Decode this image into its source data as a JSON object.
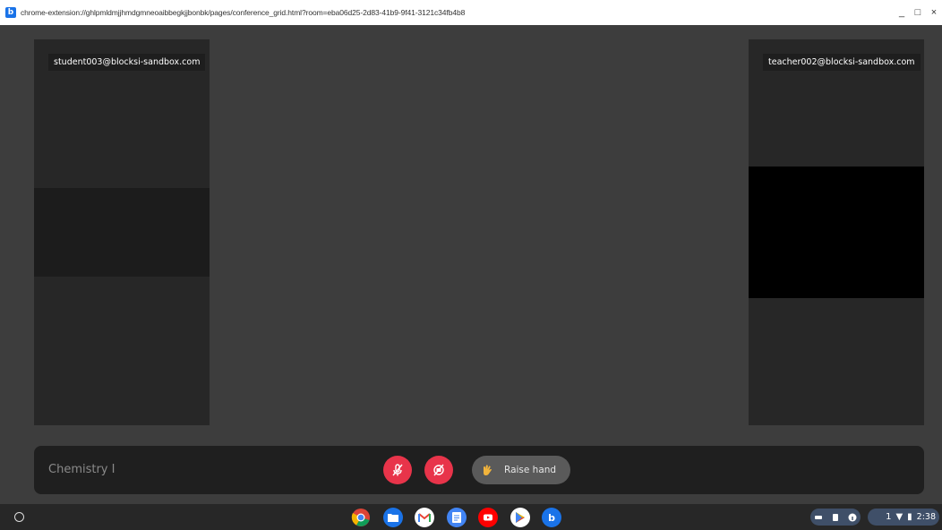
{
  "window": {
    "url": "chrome-extension://ghlpmldmjjhmdgmneoaibbegkjjbonbk/pages/conference_grid.html?room=eba06d25-2d83-41b9-9f41-3121c34fb4b8",
    "minimize_glyph": "_",
    "maximize_glyph": "□",
    "close_glyph": "×",
    "app_icon_letter": "b"
  },
  "participants": [
    {
      "name": "student003@blocksi-sandbox.com",
      "video": "off"
    },
    {
      "name": "teacher002@blocksi-sandbox.com",
      "video": "on"
    }
  ],
  "controls": {
    "room_name": "Chemistry I",
    "mic_icon": "mic-muted-icon",
    "camera_icon": "camera-off-icon",
    "raise_hand_label": "Raise hand",
    "accent_color": "#e8344a"
  },
  "shelf": {
    "apps": [
      "chrome-icon",
      "files-icon",
      "gmail-icon",
      "docs-icon",
      "youtube-icon",
      "play-store-icon",
      "blocksi-icon"
    ],
    "tray_symbols": {
      "notification": "1",
      "wifi": "▼",
      "battery": "▮"
    },
    "time": "2:38"
  }
}
